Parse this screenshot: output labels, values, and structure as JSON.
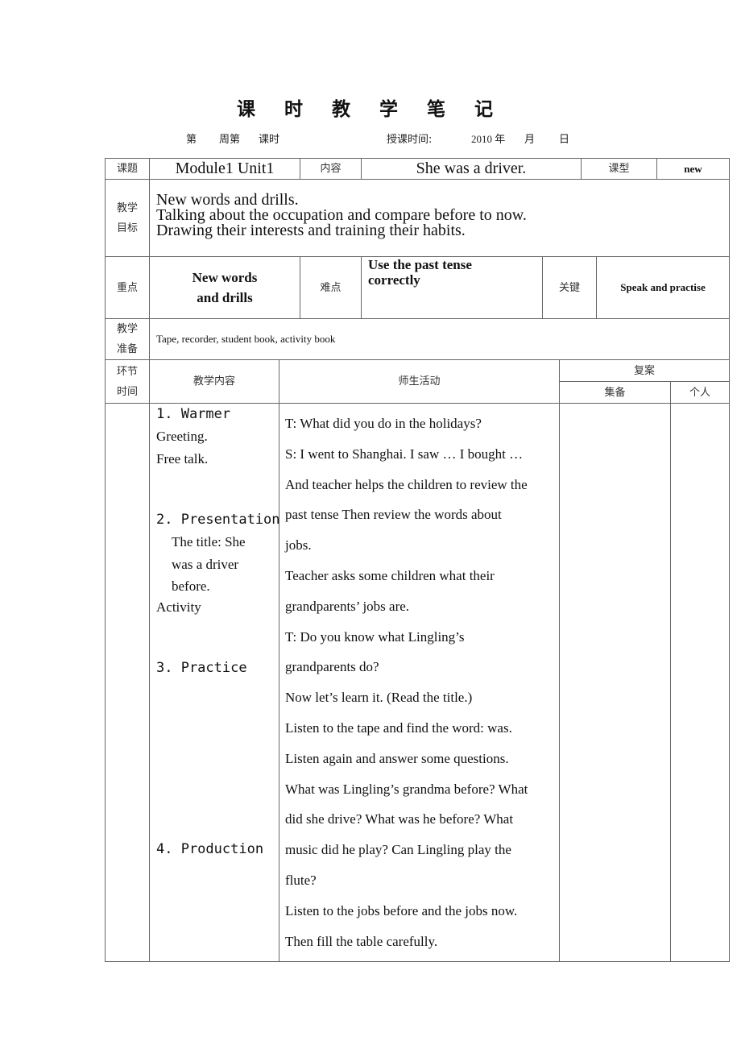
{
  "header": {
    "title": "课 时 教 学 笔 记",
    "week_label_1": "第",
    "week_label_2": "周第",
    "lesson_label": "课时",
    "date_label": "授课时间:",
    "year": "2010 年",
    "month": "月",
    "day": "日"
  },
  "row_topic": {
    "topic_label": "课题",
    "topic_value": "Module1 Unit1",
    "content_label": "内容",
    "content_value": "She was a driver.",
    "type_label": "课型",
    "type_value": "new"
  },
  "row_goals": {
    "label_line1": "教学",
    "label_line2": "目标",
    "lines": [
      "New words and drills.",
      "Talking about the occupation and compare before to now.",
      "Drawing their interests and training their habits."
    ]
  },
  "row_focus": {
    "key_point_label": "重点",
    "key_point_line1": "New words",
    "key_point_line2": "and drills",
    "difficulty_label": "难点",
    "difficulty_value_line1": "Use the past tense",
    "difficulty_value_line2": "correctly",
    "crux_label": "关键",
    "crux_value": "Speak and practise"
  },
  "row_prep": {
    "label_line1": "教学",
    "label_line2": "准备",
    "value": "Tape, recorder, student book, activity book"
  },
  "activity_header": {
    "stage_line1": "环节",
    "stage_line2": "时间",
    "content": "教学内容",
    "activities": "师生活动",
    "review": "复案",
    "group_prep": "集备",
    "individual": "个人"
  },
  "teaching_content": {
    "warmer_title": "1. Warmer",
    "warmer_items": [
      "Greeting.",
      "Free talk."
    ],
    "presentation_title": "2. Presentation",
    "presentation_items": [
      "The title: She",
      "was a driver",
      "before."
    ],
    "presentation_extra": "Activity",
    "practice_title": "3. Practice",
    "production_title": "4. Production"
  },
  "activities_lines": [
    "T: What did you do in the holidays?",
    "S: I went to Shanghai. I saw … I bought …",
    "And teacher helps the children to review the",
    "past tense Then review the words about",
    "jobs.",
    "Teacher asks some children what their",
    "grandparents’ jobs are.",
    "T: Do you know what Lingling’s",
    "grandparents do?",
    "Now let’s learn it. (Read the title.)",
    "Listen to the tape and find the word: was.",
    "Listen again and answer some questions.",
    "What was Lingling’s grandma before? What",
    "did she drive? What was he before? What",
    "music did he play? Can Lingling play the",
    "flute?",
    "Listen to the jobs before and the jobs now.",
    "Then fill the table carefully."
  ]
}
